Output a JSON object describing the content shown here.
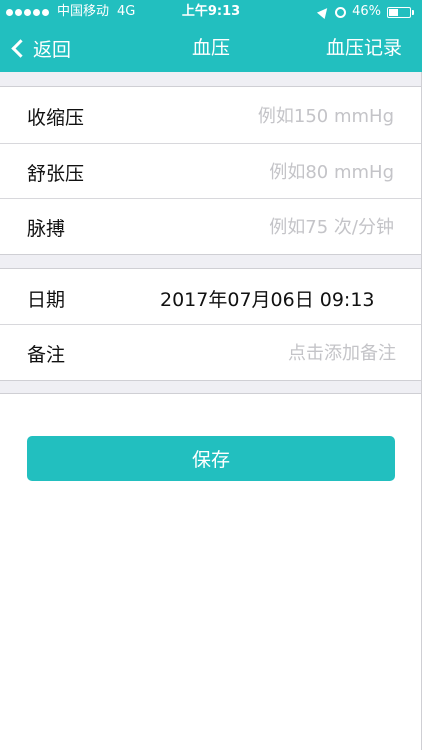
{
  "status_bar": {
    "carrier": "中国移动",
    "network": "4G",
    "time": "上午9:13",
    "battery_percent": "46%",
    "battery_level": 0.46
  },
  "nav": {
    "back_label": "返回",
    "title": "血压",
    "right_label": "血压记录"
  },
  "fields": {
    "systolic": {
      "label": "收缩压",
      "placeholder": "例如150 mmHg"
    },
    "diastolic": {
      "label": "舒张压",
      "placeholder": "例如80 mmHg"
    },
    "pulse": {
      "label": "脉搏",
      "placeholder": "例如75 次/分钟"
    },
    "date": {
      "label": "日期",
      "value": "2017年07月06日 09:13"
    },
    "note": {
      "label": "备注",
      "placeholder": "点击添加备注"
    }
  },
  "save_label": "保存",
  "colors": {
    "accent": "#22bfbf",
    "background_gap": "#efeff4",
    "placeholder": "#c4c4c8"
  }
}
